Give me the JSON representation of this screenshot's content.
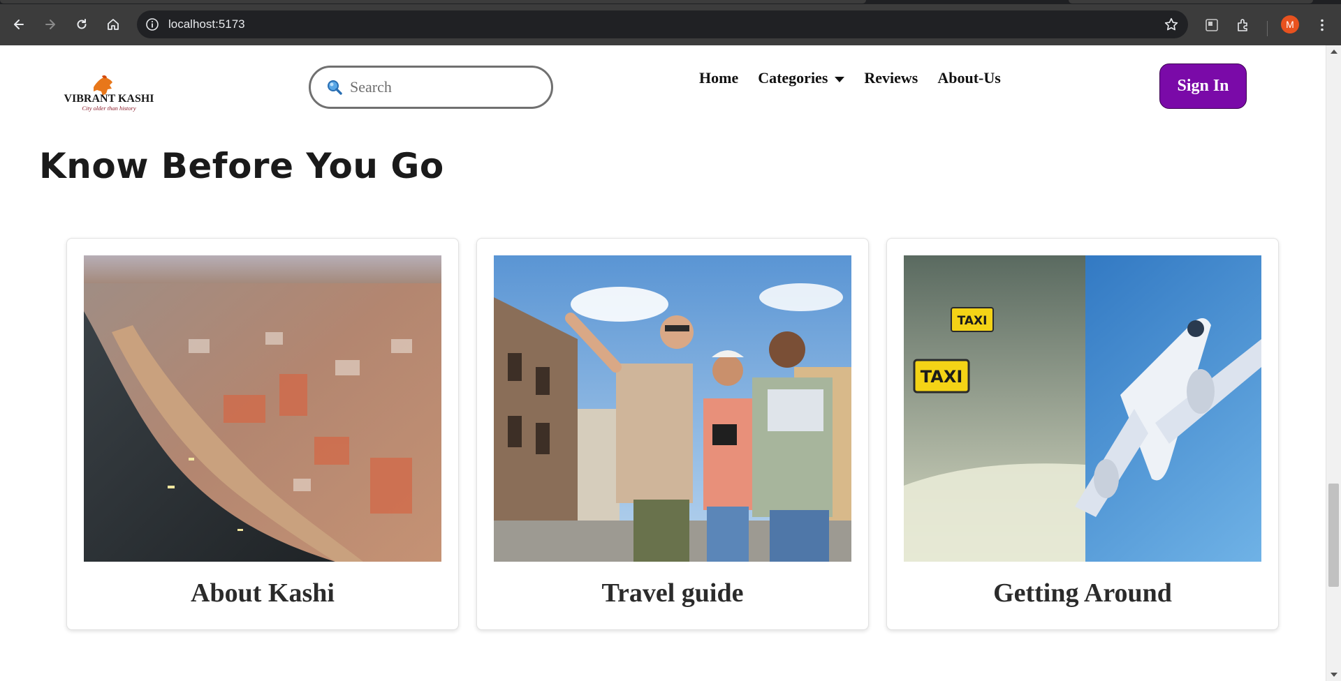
{
  "browser": {
    "url": "localhost:5173",
    "profile_initial": "M",
    "accent_color": "#e8521f"
  },
  "header": {
    "logo_text": "VIBRANT KASHI",
    "logo_tagline": "City older than history",
    "search_placeholder": "Search",
    "nav": {
      "home": "Home",
      "categories": "Categories",
      "reviews": "Reviews",
      "about": "About-Us"
    },
    "signin_label": "Sign In",
    "signin_color": "#7a0aa8"
  },
  "section": {
    "title": "Know Before You Go",
    "cards": [
      {
        "title": "About Kashi",
        "image": "aerial-ghats-photo"
      },
      {
        "title": "Travel guide",
        "image": "tourists-photo"
      },
      {
        "title": "Getting Around",
        "image": "taxi-airplane-photo"
      }
    ]
  }
}
